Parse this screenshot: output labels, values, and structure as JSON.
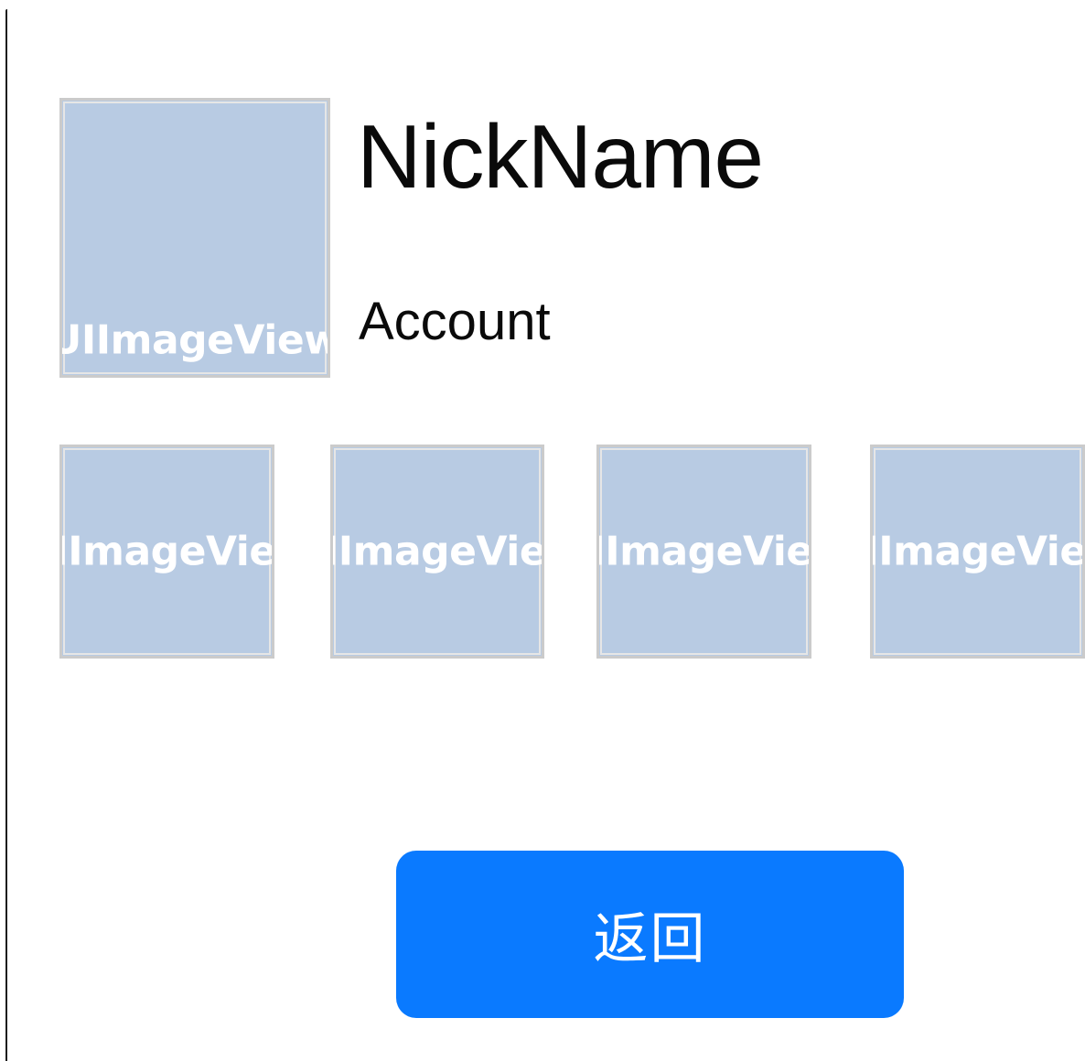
{
  "profile": {
    "avatar_label": "UIImageView",
    "nickname": "NickName",
    "account": "Account"
  },
  "gallery": {
    "items": [
      {
        "label": "UIImageView"
      },
      {
        "label": "UIImageView"
      },
      {
        "label": "UIImageView"
      },
      {
        "label": "UIImageView"
      }
    ]
  },
  "actions": {
    "back_label": "返回"
  },
  "colors": {
    "placeholder_fill": "#b8cbe3",
    "button_blue": "#0a7aff",
    "text": "#0a0a0a"
  }
}
